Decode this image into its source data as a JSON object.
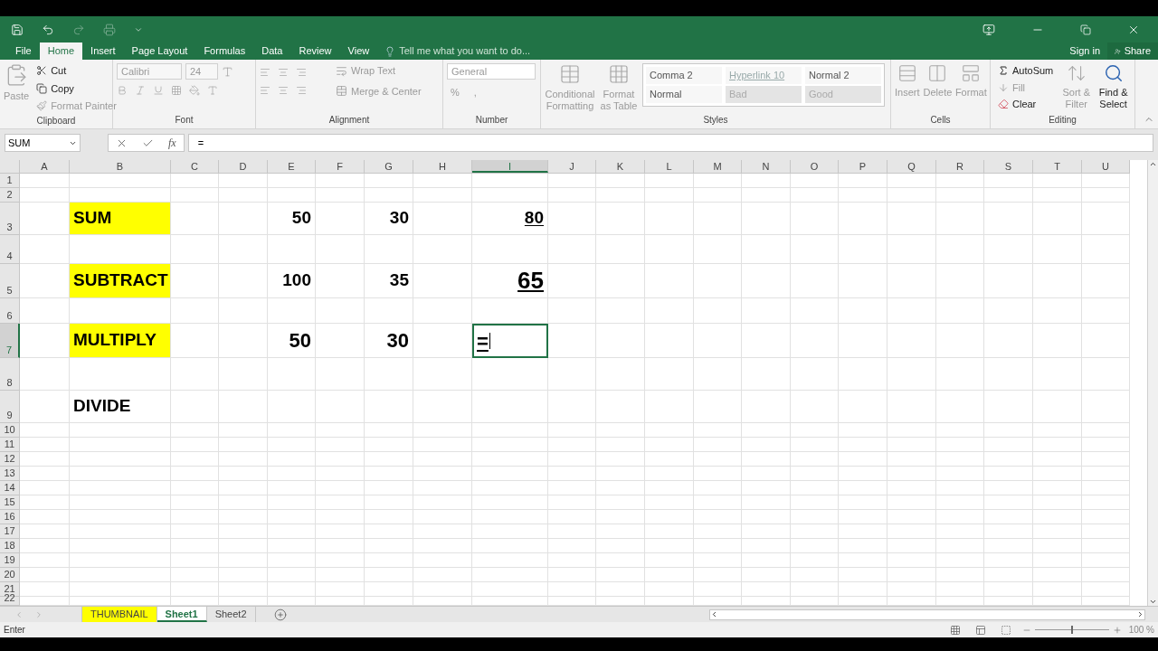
{
  "menu_tabs": [
    {
      "label": "File",
      "selected": false
    },
    {
      "label": "Home",
      "selected": true
    },
    {
      "label": "Insert",
      "selected": false
    },
    {
      "label": "Page Layout",
      "selected": false
    },
    {
      "label": "Formulas",
      "selected": false
    },
    {
      "label": "Data",
      "selected": false
    },
    {
      "label": "Review",
      "selected": false
    },
    {
      "label": "View",
      "selected": false
    }
  ],
  "tell_me": {
    "placeholder": "Tell me what you want to do..."
  },
  "account": {
    "sign_in": "Sign in",
    "share": "Share"
  },
  "ribbon": {
    "clipboard": {
      "title": "Clipboard",
      "items": [
        {
          "label": "Paste",
          "disabled": true
        },
        {
          "label": "Cut",
          "disabled": false
        },
        {
          "label": "Copy",
          "disabled": false
        },
        {
          "label": "Format Painter",
          "disabled": true
        }
      ]
    },
    "font": {
      "title": "Font",
      "font_name": "Calibri",
      "font_size": "24"
    },
    "alignment": {
      "title": "Alignment",
      "items": [
        {
          "label": "Wrap Text",
          "disabled": true
        },
        {
          "label": "Merge & Center",
          "disabled": true
        }
      ]
    },
    "number": {
      "title": "Number",
      "format": "General",
      "items": [
        {
          "label": "%",
          "disabled": true
        },
        {
          "label": ",",
          "disabled": true
        }
      ]
    },
    "styles": {
      "title": "Styles",
      "items": [
        {
          "label": "Conditional Formatting",
          "disabled": true
        },
        {
          "label": "Format as Table",
          "disabled": true
        }
      ],
      "gallery": [
        {
          "label": "Comma 2",
          "kind": "plain"
        },
        {
          "label": "Hyperlink 10",
          "kind": "link"
        },
        {
          "label": "Normal 2",
          "kind": "plain"
        },
        {
          "label": "Normal",
          "kind": "plain"
        },
        {
          "label": "Bad",
          "kind": "shaded"
        },
        {
          "label": "Good",
          "kind": "shaded"
        }
      ]
    },
    "cells": {
      "title": "Cells",
      "items": [
        {
          "label": "Insert",
          "disabled": true
        },
        {
          "label": "Delete",
          "disabled": true
        },
        {
          "label": "Format",
          "disabled": true
        }
      ]
    },
    "editing": {
      "title": "Editing",
      "items": [
        {
          "label": "AutoSum",
          "disabled": false
        },
        {
          "label": "Fill",
          "disabled": true
        },
        {
          "label": "Clear",
          "disabled": false
        },
        {
          "label": "Sort & Filter",
          "disabled": true
        },
        {
          "label": "Find & Select",
          "disabled": false
        }
      ]
    }
  },
  "name_box": "SUM",
  "formula": "=",
  "function_label": "fx",
  "columns": [
    {
      "label": "A",
      "selected": false
    },
    {
      "label": "B",
      "selected": false
    },
    {
      "label": "C",
      "selected": false
    },
    {
      "label": "D",
      "selected": false
    },
    {
      "label": "E",
      "selected": false
    },
    {
      "label": "F",
      "selected": false
    },
    {
      "label": "G",
      "selected": false
    },
    {
      "label": "H",
      "selected": false
    },
    {
      "label": "I",
      "selected": true
    },
    {
      "label": "J",
      "selected": false
    },
    {
      "label": "K",
      "selected": false
    },
    {
      "label": "L",
      "selected": false
    },
    {
      "label": "M",
      "selected": false
    },
    {
      "label": "N",
      "selected": false
    },
    {
      "label": "O",
      "selected": false
    },
    {
      "label": "P",
      "selected": false
    },
    {
      "label": "Q",
      "selected": false
    },
    {
      "label": "R",
      "selected": false
    },
    {
      "label": "S",
      "selected": false
    },
    {
      "label": "T",
      "selected": false
    },
    {
      "label": "U",
      "selected": false
    }
  ],
  "rows": [
    {
      "label": "1",
      "selected": false,
      "cells": []
    },
    {
      "label": "2",
      "selected": false,
      "cells": []
    },
    {
      "label": "3",
      "selected": false,
      "cells": [
        {
          "text": "SUM",
          "kind": "label",
          "highlight": true,
          "underline": false,
          "selected": false
        },
        {
          "text": "50",
          "kind": "number",
          "highlight": false,
          "underline": false,
          "selected": false
        },
        {
          "text": "30",
          "kind": "number",
          "highlight": false,
          "underline": false,
          "selected": false
        },
        {
          "text": "80",
          "kind": "number",
          "highlight": false,
          "underline": true,
          "selected": false
        }
      ]
    },
    {
      "label": "4",
      "selected": false,
      "cells": []
    },
    {
      "label": "5",
      "selected": false,
      "cells": [
        {
          "text": "SUBTRACT",
          "kind": "label",
          "highlight": true,
          "underline": false,
          "selected": false
        },
        {
          "text": "100",
          "kind": "number",
          "highlight": false,
          "underline": false,
          "selected": false
        },
        {
          "text": "35",
          "kind": "number",
          "highlight": false,
          "underline": false,
          "selected": false
        },
        {
          "text": "65",
          "kind": "xlarge",
          "highlight": false,
          "underline": true,
          "selected": false
        }
      ]
    },
    {
      "label": "6",
      "selected": false,
      "cells": []
    },
    {
      "label": "7",
      "selected": true,
      "cells": [
        {
          "text": "MULTIPLY",
          "kind": "label",
          "highlight": true,
          "underline": false,
          "selected": false
        },
        {
          "text": "50",
          "kind": "large",
          "highlight": false,
          "underline": false,
          "selected": false
        },
        {
          "text": "30",
          "kind": "large",
          "highlight": false,
          "underline": false,
          "selected": false
        },
        {
          "text": "=",
          "kind": "entry",
          "highlight": false,
          "underline": true,
          "selected": true
        }
      ]
    },
    {
      "label": "8",
      "selected": false,
      "cells": []
    },
    {
      "label": "9",
      "selected": false,
      "cells": [
        {
          "text": "DIVIDE",
          "kind": "label",
          "highlight": false,
          "underline": false,
          "selected": false
        }
      ]
    },
    {
      "label": "10",
      "selected": false,
      "cells": []
    },
    {
      "label": "11",
      "selected": false,
      "cells": []
    },
    {
      "label": "12",
      "selected": false,
      "cells": []
    },
    {
      "label": "13",
      "selected": false,
      "cells": []
    },
    {
      "label": "14",
      "selected": false,
      "cells": []
    },
    {
      "label": "15",
      "selected": false,
      "cells": []
    },
    {
      "label": "16",
      "selected": false,
      "cells": []
    },
    {
      "label": "17",
      "selected": false,
      "cells": []
    },
    {
      "label": "18",
      "selected": false,
      "cells": []
    },
    {
      "label": "19",
      "selected": false,
      "cells": []
    },
    {
      "label": "20",
      "selected": false,
      "cells": []
    },
    {
      "label": "21",
      "selected": false,
      "cells": []
    },
    {
      "label": "22",
      "selected": false,
      "cells": []
    }
  ],
  "sheet_tabs": [
    {
      "label": "THUMBNAIL",
      "selected": false,
      "color": "#ffff00"
    },
    {
      "label": "Sheet1",
      "selected": true
    },
    {
      "label": "Sheet2",
      "selected": false
    }
  ],
  "status_bar": {
    "mode": "Enter",
    "zoom": {
      "level": 0.5,
      "reading": "100 %"
    }
  }
}
